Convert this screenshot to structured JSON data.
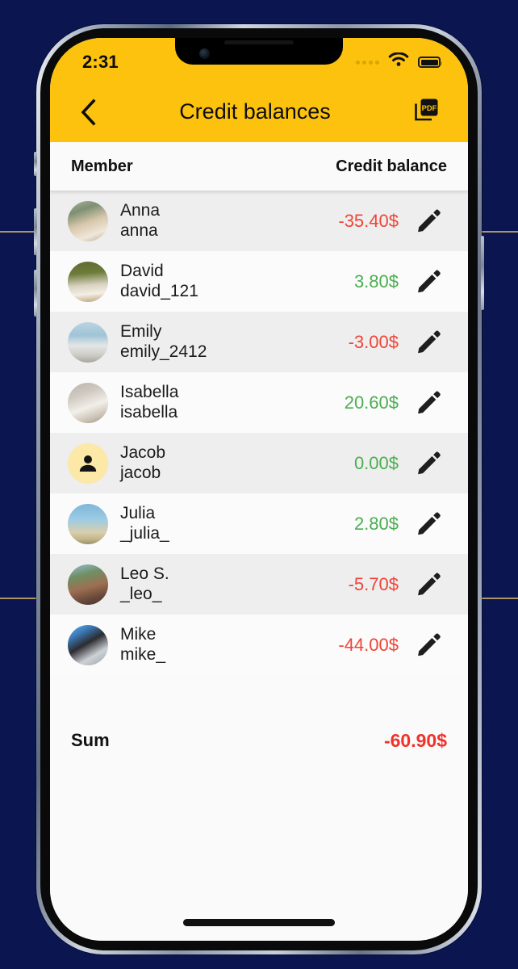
{
  "status_bar": {
    "time": "2:31",
    "signal_icon": "signal-dots-icon",
    "wifi_icon": "wifi-icon",
    "battery_icon": "battery-full-icon"
  },
  "app_bar": {
    "back_icon": "chevron-left-icon",
    "title": "Credit balances",
    "pdf_label": "PDF",
    "pdf_icon": "pdf-export-icon"
  },
  "table": {
    "headers": {
      "member": "Member",
      "balance": "Credit balance"
    },
    "rows": [
      {
        "name": "Anna",
        "username": "anna",
        "amount": "-35.40$",
        "sign": "neg",
        "avatar": "photo-anna",
        "edit_icon": "pencil-icon"
      },
      {
        "name": "David",
        "username": "david_121",
        "amount": "3.80$",
        "sign": "pos",
        "avatar": "photo-david",
        "edit_icon": "pencil-icon"
      },
      {
        "name": "Emily",
        "username": "emily_2412",
        "amount": "-3.00$",
        "sign": "neg",
        "avatar": "photo-emily",
        "edit_icon": "pencil-icon"
      },
      {
        "name": "Isabella",
        "username": "isabella",
        "amount": "20.60$",
        "sign": "pos",
        "avatar": "photo-isabella",
        "edit_icon": "pencil-icon"
      },
      {
        "name": "Jacob",
        "username": "jacob",
        "amount": "0.00$",
        "sign": "pos",
        "avatar": "placeholder-person",
        "edit_icon": "pencil-icon"
      },
      {
        "name": "Julia",
        "username": "_julia_",
        "amount": "2.80$",
        "sign": "pos",
        "avatar": "photo-julia",
        "edit_icon": "pencil-icon"
      },
      {
        "name": "Leo S.",
        "username": "_leo_",
        "amount": "-5.70$",
        "sign": "neg",
        "avatar": "photo-leo",
        "edit_icon": "pencil-icon"
      },
      {
        "name": "Mike",
        "username": "mike_",
        "amount": "-44.00$",
        "sign": "neg",
        "avatar": "photo-mike",
        "edit_icon": "pencil-icon"
      }
    ],
    "sum": {
      "label": "Sum",
      "amount": "-60.90$",
      "sign": "neg"
    }
  },
  "colors": {
    "brand_yellow": "#fdc20d",
    "negative_red": "#f04437",
    "positive_green": "#4aae4f",
    "sum_red": "#f0332a",
    "row_alt": "#eeeeee",
    "backdrop_navy": "#0b1550"
  }
}
